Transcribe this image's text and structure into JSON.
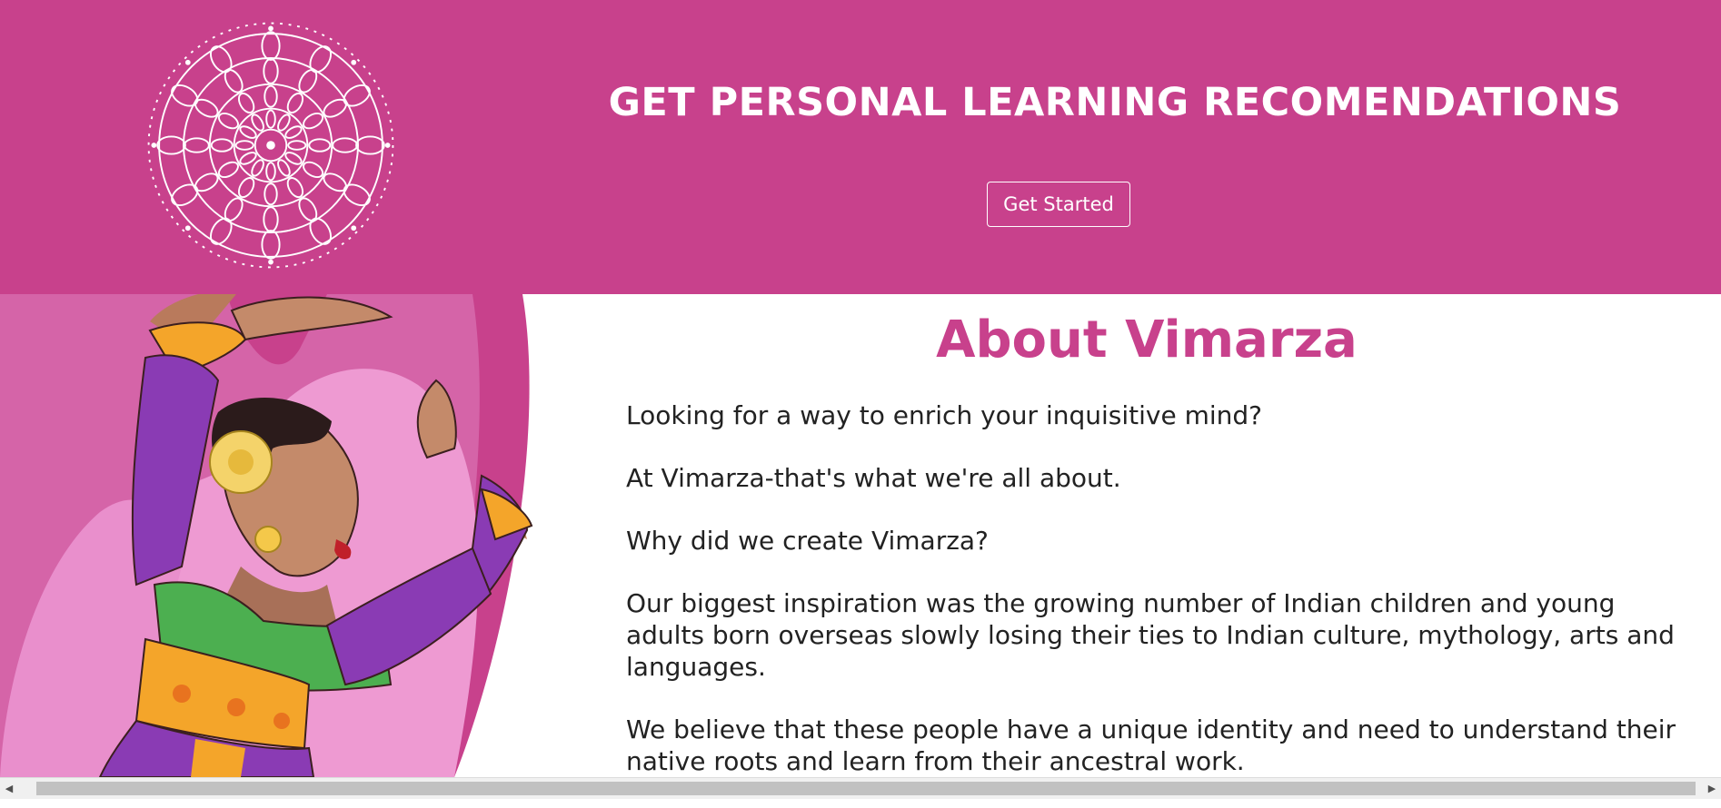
{
  "hero": {
    "title": "GET PERSONAL LEARNING RECOMENDATIONS",
    "cta_label": "Get Started",
    "background": "#c8418c",
    "logo_icon": "mandala-icon"
  },
  "illustration": {
    "icon": "dancer-illustration"
  },
  "about": {
    "title": "About Vimarza",
    "title_color": "#c8418c",
    "paragraphs": [
      "Looking for a way to enrich your inquisitive mind?",
      "At Vimarza-that's what we're all about.",
      "Why did we create Vimarza?",
      "Our biggest inspiration was the growing number of Indian children and young adults born overseas slowly losing their ties to Indian culture, mythology, arts and languages.",
      "We believe that these people have a unique identity and need to understand their native roots and learn from their ancestral work."
    ]
  },
  "scrollbar": {
    "left_icon": "arrow-left-icon",
    "right_icon": "arrow-right-icon"
  }
}
